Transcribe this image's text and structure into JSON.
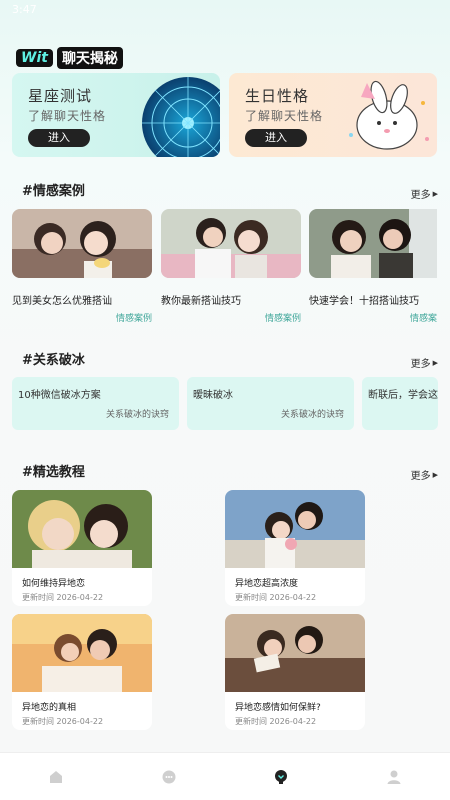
{
  "status": {
    "time": "3:47"
  },
  "brand": {
    "wit": "Wit",
    "title": "聊天揭秘"
  },
  "features": [
    {
      "title": "星座测试",
      "subtitle": "了解聊天性格",
      "button": "进入"
    },
    {
      "title": "生日性格",
      "subtitle": "了解聊天性格",
      "button": "进入"
    }
  ],
  "cases": {
    "heading": "#情感案例",
    "more": "更多",
    "items": [
      {
        "title": "见到美女怎么优雅搭讪",
        "tag": "情感案例"
      },
      {
        "title": "教你最新搭讪技巧",
        "tag": "情感案例"
      },
      {
        "title": "快速学会！十招搭讪技巧",
        "tag": "情感案"
      }
    ]
  },
  "icebreak": {
    "heading": "#关系破冰",
    "more": "更多",
    "items": [
      {
        "title": "10种微信破冰方案",
        "subtitle": "关系破冰的诀窍"
      },
      {
        "title": "暧昧破冰",
        "subtitle": "关系破冰的诀窍"
      },
      {
        "title": "断联后，学会这",
        "subtitle": ""
      }
    ]
  },
  "tutorials": {
    "heading": "#精选教程",
    "more": "更多",
    "items": [
      {
        "title": "如何维持异地恋",
        "date": "更新时间 2026-04-22"
      },
      {
        "title": "异地恋超高浓度",
        "date": "更新时间 2026-04-22"
      },
      {
        "title": "异地恋的真相",
        "date": "更新时间 2026-04-22"
      },
      {
        "title": "异地恋感情如何保鲜?",
        "date": "更新时间 2026-04-22"
      }
    ]
  },
  "nav": [
    "home-icon",
    "chat-icon",
    "bulb-icon",
    "profile-icon"
  ]
}
